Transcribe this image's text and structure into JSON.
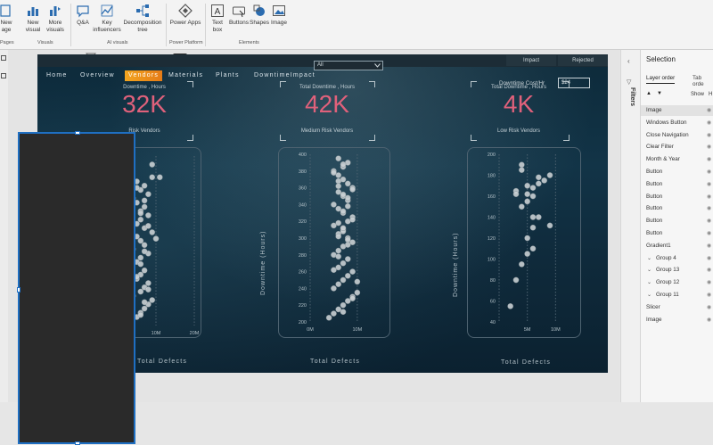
{
  "ribbon": {
    "buttons": [
      {
        "label": "New\nage",
        "icon": "new-page-icon"
      },
      {
        "label": "New\nvisual",
        "icon": "new-visual-icon"
      },
      {
        "label": "More\nvisuals",
        "icon": "more-visuals-icon"
      },
      {
        "label": "Q&A",
        "icon": "qa-icon"
      },
      {
        "label": "Key\ninfluencers",
        "icon": "key-influencers-icon"
      },
      {
        "label": "Decomposition\ntree",
        "icon": "decomposition-tree-icon"
      },
      {
        "label": "Power Apps",
        "icon": "power-apps-icon"
      },
      {
        "label": "Text\nbox",
        "icon": "text-box-icon"
      },
      {
        "label": "Buttons",
        "icon": "buttons-icon"
      },
      {
        "label": "Shapes",
        "icon": "shapes-icon"
      },
      {
        "label": "Image",
        "icon": "image-icon"
      }
    ],
    "groups": [
      "Pages",
      "Visuals",
      "AI visuals",
      "Power Platform",
      "Elements"
    ]
  },
  "report": {
    "nav": [
      "Home",
      "Overview",
      "Vendors",
      "Materials",
      "Plants",
      "DowntimeImpact"
    ],
    "nav_active": "Vendors",
    "impact_tab": "Impact",
    "rejected_tab": "Rejected",
    "slicer_value": "All",
    "cost_label": "Downtime Cost/Hr",
    "cost_value": "$24",
    "kpis": [
      {
        "title": "Downtime , Hours",
        "value": "32K",
        "sub": "Risk Vendors",
        "full_title": "Total Downtime , Hours"
      },
      {
        "title": "Total Downtime , Hours",
        "value": "42K",
        "sub": "Medium Risk Vendors"
      },
      {
        "title": "Total Downtime , Hours",
        "value": "4K",
        "sub": "Low Risk Vendors"
      }
    ],
    "y_axis_title": "Downtime (Hours)",
    "x_axis_title": "Total Defects"
  },
  "chart_data": [
    {
      "type": "scatter",
      "title": "",
      "xlabel": "Total Defects",
      "ylabel": "Downtime (Hours)",
      "x_ticks": [
        "10M",
        "20M"
      ],
      "points": {
        "x": [
          5,
          6,
          7,
          8,
          9,
          4,
          6,
          7,
          8,
          5,
          6,
          7,
          3,
          5,
          6,
          8,
          4,
          7,
          6,
          5,
          9,
          7,
          5,
          6,
          8,
          6,
          7,
          5,
          4,
          8,
          6,
          7,
          5,
          9,
          6,
          7,
          8,
          5,
          6,
          7,
          10,
          8,
          6,
          7,
          5,
          11,
          9
        ],
        "y": [
          60,
          70,
          80,
          90,
          100,
          110,
          120,
          130,
          140,
          150,
          160,
          170,
          180,
          190,
          200,
          210,
          220,
          230,
          240,
          250,
          260,
          270,
          280,
          290,
          300,
          310,
          320,
          330,
          340,
          350,
          360,
          370,
          380,
          390,
          65,
          95,
          125,
          155,
          185,
          215,
          245,
          275,
          305,
          335,
          365,
          390,
          420
        ]
      }
    },
    {
      "type": "scatter",
      "title": "",
      "xlabel": "Total Defects",
      "ylabel": "Downtime (Hours)",
      "ylim": [
        200,
        400
      ],
      "y_ticks": [
        200,
        220,
        240,
        260,
        280,
        300,
        320,
        340,
        360,
        380,
        400
      ],
      "x_ticks": [
        "0M",
        "10M"
      ],
      "points": {
        "x": [
          4,
          5,
          6,
          7,
          8,
          9,
          10,
          5,
          6,
          7,
          8,
          9,
          6,
          7,
          8,
          5,
          6,
          7,
          9,
          8,
          6,
          7,
          5,
          8,
          9,
          7,
          6,
          5,
          8,
          7,
          6,
          9,
          8,
          7,
          6,
          5,
          7,
          8,
          6,
          7,
          9,
          10,
          5,
          6,
          8,
          7,
          6,
          7,
          8,
          9,
          6,
          5,
          7,
          8,
          6,
          7,
          9,
          8,
          7,
          6
        ],
        "y": [
          205,
          210,
          215,
          220,
          225,
          230,
          235,
          240,
          245,
          250,
          255,
          260,
          265,
          270,
          275,
          280,
          285,
          290,
          295,
          300,
          305,
          310,
          315,
          320,
          325,
          330,
          335,
          340,
          345,
          350,
          355,
          360,
          365,
          370,
          375,
          380,
          385,
          390,
          395,
          212,
          228,
          248,
          262,
          278,
          292,
          308,
          318,
          332,
          348,
          358,
          368,
          378,
          388,
          298,
          302,
          312,
          322,
          338,
          352,
          362
        ]
      }
    },
    {
      "type": "scatter",
      "title": "",
      "xlabel": "Total Defects",
      "ylabel": "Downtime (Hours)",
      "ylim": [
        40,
        200
      ],
      "y_ticks": [
        40,
        60,
        80,
        100,
        120,
        140,
        160,
        180,
        200
      ],
      "x_ticks": [
        "5M",
        "10M"
      ],
      "points": {
        "x": [
          2,
          3,
          4,
          5,
          6,
          5,
          6,
          7,
          4,
          5,
          6,
          3,
          5,
          7,
          8,
          9,
          4,
          6,
          5,
          6,
          7,
          4,
          9,
          3
        ],
        "y": [
          55,
          80,
          95,
          105,
          110,
          120,
          130,
          140,
          150,
          155,
          160,
          165,
          170,
          172,
          175,
          180,
          185,
          140,
          162,
          168,
          178,
          190,
          132,
          162
        ]
      }
    }
  ],
  "selection": {
    "title": "Selection",
    "tab_layer": "Layer order",
    "tab_order": "Tab orde",
    "show_label": "Show",
    "hide_label": "H",
    "filters_label": "Filters",
    "layers": [
      {
        "name": "Image",
        "indent": 0,
        "selected": true
      },
      {
        "name": "Windows Button",
        "indent": 0
      },
      {
        "name": "Close Navigation",
        "indent": 0
      },
      {
        "name": "Clear Filter",
        "indent": 0
      },
      {
        "name": "Month & Year",
        "indent": 0
      },
      {
        "name": "Button",
        "indent": 0
      },
      {
        "name": "Button",
        "indent": 0
      },
      {
        "name": "Button",
        "indent": 0
      },
      {
        "name": "Button",
        "indent": 0
      },
      {
        "name": "Button",
        "indent": 0
      },
      {
        "name": "Button",
        "indent": 0
      },
      {
        "name": "Gradient1",
        "indent": 0
      },
      {
        "name": "Group 4",
        "indent": 1
      },
      {
        "name": "Group 13",
        "indent": 1
      },
      {
        "name": "Group 12",
        "indent": 1
      },
      {
        "name": "Group 11",
        "indent": 1
      },
      {
        "name": "Slicer",
        "indent": 0
      },
      {
        "name": "Image",
        "indent": 0
      }
    ]
  }
}
